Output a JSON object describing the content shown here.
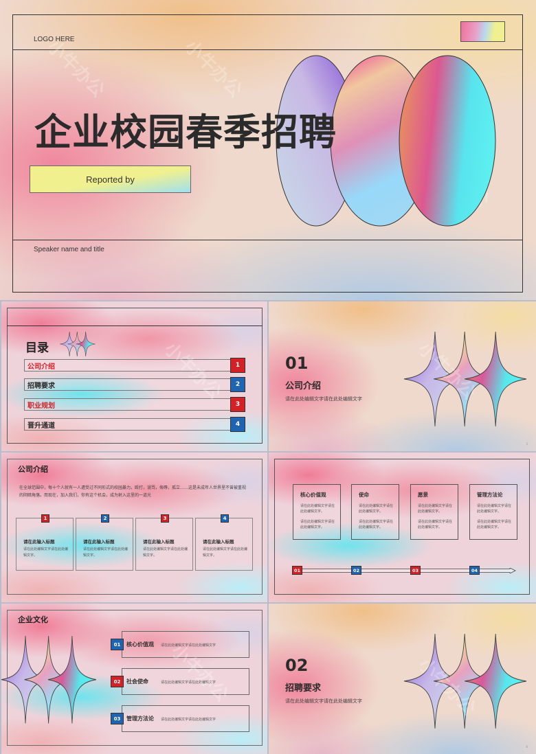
{
  "slide_title": {
    "logo": "LOGO HERE",
    "title": "企业校园春季招聘",
    "reported_by": "Reported by",
    "speaker": "Speaker name and title"
  },
  "toc": {
    "title": "目录",
    "items": [
      {
        "label": "公司介绍",
        "num": "1",
        "label_color": "#d42027",
        "badge_color": "#d42027"
      },
      {
        "label": "招聘要求",
        "num": "2",
        "label_color": "#2b2b2b",
        "badge_color": "#1f64b0"
      },
      {
        "label": "职业规划",
        "num": "3",
        "label_color": "#d42027",
        "badge_color": "#d42027"
      },
      {
        "label": "晋升通道",
        "num": "4",
        "label_color": "#2b2b2b",
        "badge_color": "#1f64b0"
      }
    ]
  },
  "section1": {
    "num": "01",
    "title": "公司介绍",
    "subtitle": "请在此处编辑文字请在此处编辑文字"
  },
  "company_intro": {
    "heading": "公司介绍",
    "paragraph": "在全球范围中，每十个人就有一人遭受过不同形式的校园暴力。殴打，谩骂，侮辱，孤立……这是未成年人世界里不曾被重视的阴暗角落。而现在，加入我们，你有这个机会，成为射入这里的一道光",
    "cards": [
      {
        "num": "1",
        "title": "请在此输入标题",
        "desc": "请在此处编辑文字请在此处编辑文字。"
      },
      {
        "num": "2",
        "title": "请在此输入标题",
        "desc": "请在此处编辑文字请在此处编辑文字。"
      },
      {
        "num": "3",
        "title": "请在此输入标题",
        "desc": "请在此处编辑文字请在此处编辑文字。"
      },
      {
        "num": "4",
        "title": "请在此输入标题",
        "desc": "请在此处编辑文字请在此处编辑文字。"
      }
    ]
  },
  "values": {
    "cards": [
      {
        "title": "核心价值观",
        "desc1": "请在此处编辑文字请在此处编辑文字。",
        "desc2": "请在此处编辑文字请在此处编辑文字。"
      },
      {
        "title": "使命",
        "desc1": "请在此处编辑文字请在此处编辑文字。",
        "desc2": "请在此处编辑文字请在此处编辑文字。"
      },
      {
        "title": "愿景",
        "desc1": "请在此处编辑文字请在此处编辑文字。",
        "desc2": "请在此处编辑文字请在此处编辑文字。"
      },
      {
        "title": "管理方法论",
        "desc1": "请在此处编辑文字请在此处编辑文字。",
        "desc2": "请在此处编辑文字请在此处编辑文字。"
      }
    ],
    "timeline": [
      "01",
      "02",
      "03",
      "04"
    ]
  },
  "culture": {
    "heading": "企业文化",
    "rows": [
      {
        "num": "01",
        "title": "核心价值观",
        "desc": "请在此处编辑文字请在此处编辑文字"
      },
      {
        "num": "02",
        "title": "社会使命",
        "desc": "请在此处编辑文字请在此处编辑文字"
      },
      {
        "num": "03",
        "title": "管理方法论",
        "desc": "请在此处编辑文字请在此处编辑文字"
      }
    ]
  },
  "section2": {
    "num": "02",
    "title": "招聘要求",
    "subtitle": "请在此处编辑文字请在此处编辑文字"
  },
  "watermark": "小牛办公",
  "colors": {
    "red": "#d42027",
    "blue": "#1f64b0",
    "text": "#2b2b2b"
  }
}
